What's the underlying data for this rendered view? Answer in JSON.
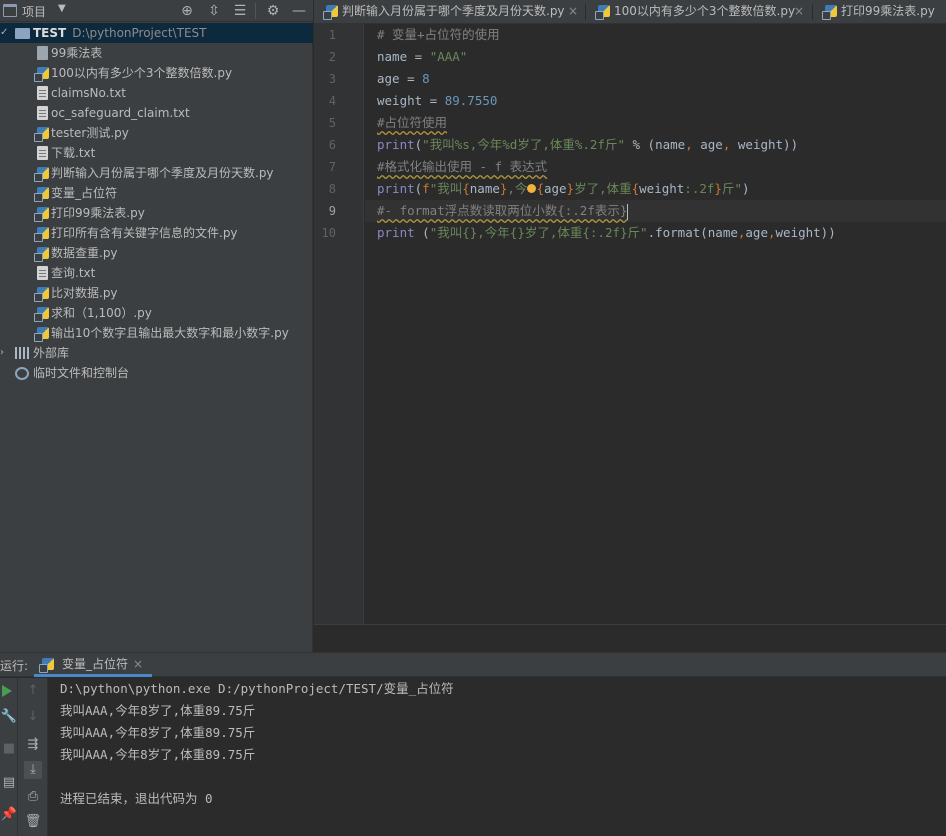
{
  "project_panel": {
    "title": "项目",
    "tree": [
      {
        "label": "TEST",
        "path": "D:\\pythonProject\\TEST",
        "type": "folder",
        "depth": 0,
        "expanded": true,
        "selected": true
      },
      {
        "label": "99乘法表",
        "type": "file",
        "depth": 1
      },
      {
        "label": "100以内有多少个3个整数倍数.py",
        "type": "py",
        "depth": 1
      },
      {
        "label": "claimsNo.txt",
        "type": "txt",
        "depth": 1
      },
      {
        "label": "oc_safeguard_claim.txt",
        "type": "txt",
        "depth": 1
      },
      {
        "label": "tester测试.py",
        "type": "py",
        "depth": 1
      },
      {
        "label": "下载.txt",
        "type": "txt",
        "depth": 1
      },
      {
        "label": "判断输入月份属于哪个季度及月份天数.py",
        "type": "py",
        "depth": 1
      },
      {
        "label": "变量_占位符",
        "type": "py",
        "depth": 1
      },
      {
        "label": "打印99乘法表.py",
        "type": "py",
        "depth": 1
      },
      {
        "label": "打印所有含有关键字信息的文件.py",
        "type": "py",
        "depth": 1
      },
      {
        "label": "数据查重.py",
        "type": "py",
        "depth": 1
      },
      {
        "label": "查询.txt",
        "type": "txt",
        "depth": 1
      },
      {
        "label": "比对数据.py",
        "type": "py",
        "depth": 1
      },
      {
        "label": "求和（1,100）.py",
        "type": "py",
        "depth": 1
      },
      {
        "label": "输出10个数字且输出最大数字和最小数字.py",
        "type": "py",
        "depth": 1
      },
      {
        "label": "外部库",
        "type": "lib",
        "depth": 0,
        "expanded": false
      },
      {
        "label": "临时文件和控制台",
        "type": "scratch",
        "depth": 0
      }
    ]
  },
  "editor_tabs": [
    {
      "label": "判断输入月份属于哪个季度及月份天数.py"
    },
    {
      "label": "100以内有多少个3个整数倍数.py"
    },
    {
      "label": "打印99乘法表.py"
    }
  ],
  "editor": {
    "current_line": 9,
    "lines": [
      {
        "n": "1"
      },
      {
        "n": "2"
      },
      {
        "n": "3"
      },
      {
        "n": "4"
      },
      {
        "n": "5"
      },
      {
        "n": "6"
      },
      {
        "n": "7"
      },
      {
        "n": "8"
      },
      {
        "n": "9"
      },
      {
        "n": "10"
      }
    ]
  },
  "run_panel": {
    "label": "运行:",
    "tab_label": "变量_占位符",
    "output": [
      "D:\\python\\python.exe D:/pythonProject/TEST/变量_占位符",
      "我叫AAA,今年8岁了,体重89.75斤",
      "我叫AAA,今年8岁了,体重89.75斤",
      "我叫AAA,今年8岁了,体重89.75斤",
      "",
      "进程已结束，退出代码为 0"
    ]
  },
  "colors": {
    "keyword": "#cc7832",
    "string": "#6a8759",
    "number": "#6897bb",
    "comment": "#808080",
    "builtin": "#8888c6",
    "selection": "#0d293e",
    "run_green": "#499c54"
  },
  "icons": {
    "project_toolbar": [
      "locate-icon",
      "expand-all-icon",
      "collapse-all-icon",
      "gear-icon",
      "hide-icon"
    ],
    "run_toolbar": [
      "run-icon",
      "wrench-icon",
      "stop-icon",
      "layout-icon",
      "pin-icon",
      "up-arrow-icon",
      "down-arrow-icon",
      "soft-wrap-icon",
      "scroll-to-end-icon",
      "print-icon",
      "trash-icon"
    ]
  }
}
